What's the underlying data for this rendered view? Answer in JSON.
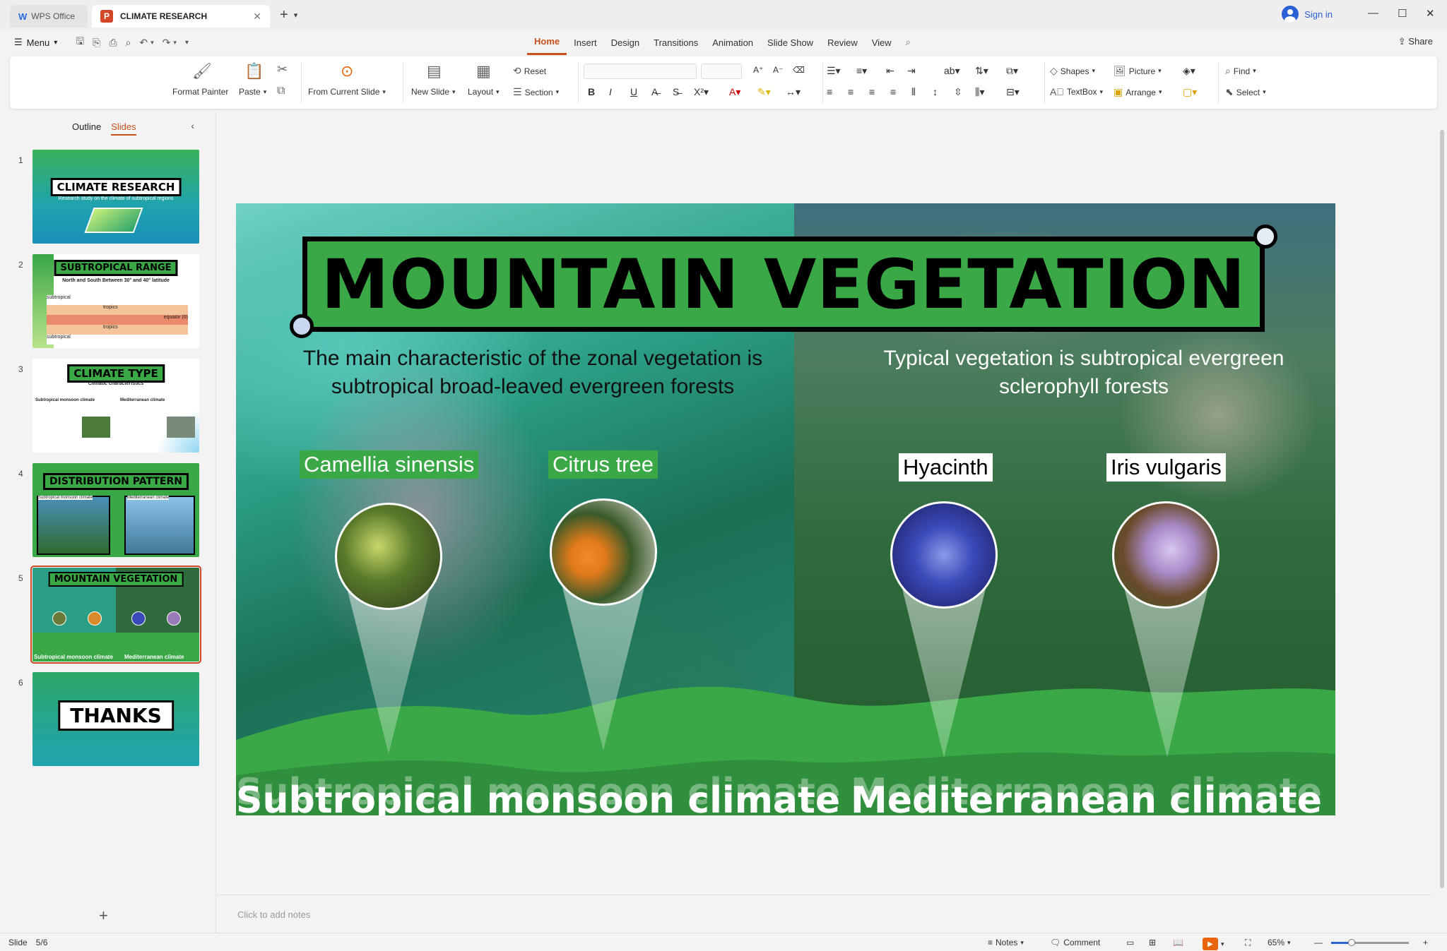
{
  "titlebar": {
    "wps_tab": "WPS Office",
    "doc_tab": "CLIMATE RESEARCH",
    "doc_icon": "P",
    "sign_in": "Sign in"
  },
  "menubar": {
    "menu": "Menu",
    "tabs": [
      "Home",
      "Insert",
      "Design",
      "Transitions",
      "Animation",
      "Slide Show",
      "Review",
      "View"
    ],
    "active_tab": "Home",
    "share": "Share"
  },
  "ribbon": {
    "format_painter": "Format Painter",
    "paste": "Paste",
    "from_current_slide": "From Current Slide",
    "new_slide": "New Slide",
    "layout": "Layout",
    "reset": "Reset",
    "section": "Section",
    "shapes": "Shapes",
    "picture": "Picture",
    "textbox": "TextBox",
    "arrange": "Arrange",
    "find": "Find",
    "select": "Select"
  },
  "panel": {
    "outline": "Outline",
    "slides": "Slides",
    "thumbnails": [
      {
        "num": "1",
        "title": "CLIMATE RESEARCH",
        "subtitle": "Research study on the climate of subtropical regions"
      },
      {
        "num": "2",
        "title": "SUBTROPICAL RANGE",
        "subtitle": "North and South Between 30° and 40° latitude",
        "rows": [
          "subtropical",
          "tropics",
          "equator (0)",
          "tropics",
          "subtropical"
        ]
      },
      {
        "num": "3",
        "title": "CLIMATE TYPE",
        "subtitle": "Climatic characteristics",
        "left": "Subtropical monsoon climate",
        "right": "Mediterranean climate"
      },
      {
        "num": "4",
        "title": "DISTRIBUTION PATTERN",
        "left": "Subtropical monsoon climate",
        "right": "Mediterranean climate"
      },
      {
        "num": "5",
        "title": "MOUNTAIN VEGETATION",
        "bottom_left": "Subtropical monsoon climate",
        "bottom_right": "Mediterranean climate"
      },
      {
        "num": "6",
        "title": "THANKS"
      }
    ]
  },
  "slide": {
    "title": "MOUNTAIN VEGETATION",
    "left_subtitle": "The main characteristic of the zonal vegetation is subtropical broad-leaved evergreen forests",
    "right_subtitle": "Typical vegetation is subtropical evergreen sclerophyll forests",
    "plants": [
      "Camellia sinensis",
      "Citrus tree",
      "Hyacinth",
      "Iris vulgaris"
    ],
    "left_climate": "Subtropical monsoon climate",
    "right_climate": "Mediterranean climate"
  },
  "notes_placeholder": "Click to add notes",
  "status": {
    "slide_label": "Slide",
    "slide_count": "5/6",
    "notes": "Notes",
    "comment": "Comment",
    "zoom": "65%",
    "zoom_fraction": 0.65
  },
  "colors": {
    "accent": "#c8501c",
    "title_green": "#3aa846",
    "link_blue": "#2b5fd6"
  }
}
